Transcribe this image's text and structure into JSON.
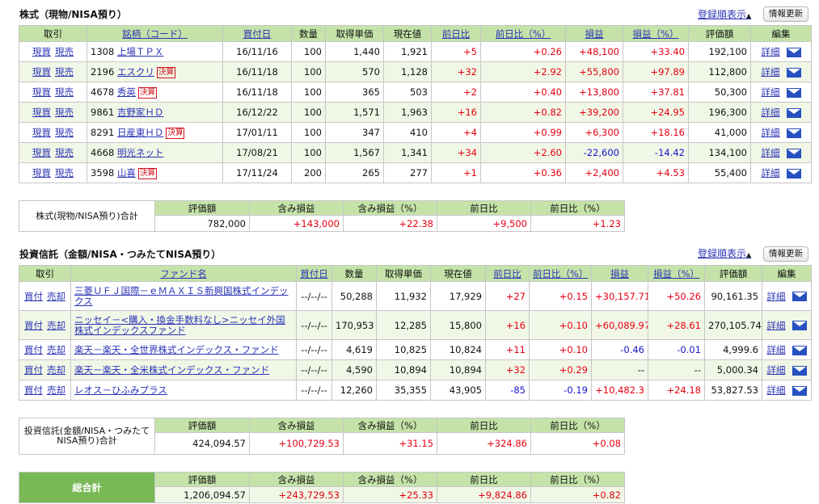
{
  "stocks": {
    "title": "株式（現物/NISA預り）",
    "sort_label": "登録順表示",
    "refresh_label": "情報更新",
    "headers": [
      "取引",
      "銘柄（コード）",
      "買付日",
      "数量",
      "取得単価",
      "現在値",
      "前日比",
      "前日比（%）",
      "損益",
      "損益（%）",
      "評価額",
      "編集"
    ],
    "trade_buy": "現買",
    "trade_sell": "現売",
    "detail_label": "詳細",
    "kessan_label": "決算",
    "rows": [
      {
        "code": "1308",
        "name": "上場ＴＰＸ",
        "kessan": false,
        "date": "16/11/16",
        "qty": "100",
        "cost": "1,440",
        "price": "1,921",
        "chg": "+5",
        "chgpct": "+0.26",
        "pl": "+48,100",
        "plpct": "+33.40",
        "value": "192,100"
      },
      {
        "code": "2196",
        "name": "エスクリ",
        "kessan": true,
        "date": "16/11/18",
        "qty": "100",
        "cost": "570",
        "price": "1,128",
        "chg": "+32",
        "chgpct": "+2.92",
        "pl": "+55,800",
        "plpct": "+97.89",
        "value": "112,800"
      },
      {
        "code": "4678",
        "name": "秀英",
        "kessan": true,
        "date": "16/11/18",
        "qty": "100",
        "cost": "365",
        "price": "503",
        "chg": "+2",
        "chgpct": "+0.40",
        "pl": "+13,800",
        "plpct": "+37.81",
        "value": "50,300"
      },
      {
        "code": "9861",
        "name": "吉野家ＨＤ",
        "kessan": false,
        "date": "16/12/22",
        "qty": "100",
        "cost": "1,571",
        "price": "1,963",
        "chg": "+16",
        "chgpct": "+0.82",
        "pl": "+39,200",
        "plpct": "+24.95",
        "value": "196,300"
      },
      {
        "code": "8291",
        "name": "日産東ＨＤ",
        "kessan": true,
        "date": "17/01/11",
        "qty": "100",
        "cost": "347",
        "price": "410",
        "chg": "+4",
        "chgpct": "+0.99",
        "pl": "+6,300",
        "plpct": "+18.16",
        "value": "41,000"
      },
      {
        "code": "4668",
        "name": "明光ネット",
        "kessan": false,
        "date": "17/08/21",
        "qty": "100",
        "cost": "1,567",
        "price": "1,341",
        "chg": "+34",
        "chgpct": "+2.60",
        "pl": "-22,600",
        "plpct": "-14.42",
        "value": "134,100"
      },
      {
        "code": "3598",
        "name": "山喜",
        "kessan": true,
        "date": "17/11/24",
        "qty": "200",
        "cost": "265",
        "price": "277",
        "chg": "+1",
        "chgpct": "+0.36",
        "pl": "+2,400",
        "plpct": "+4.53",
        "value": "55,400"
      }
    ],
    "total": {
      "label": "株式(現物/NISA預り)合計",
      "headers": [
        "評価額",
        "含み損益",
        "含み損益（%）",
        "前日比",
        "前日比（%）"
      ],
      "values": [
        "782,000",
        "+143,000",
        "+22.38",
        "+9,500",
        "+1.23"
      ]
    }
  },
  "funds": {
    "title": "投資信託（金額/NISA・つみたてNISA預り）",
    "sort_label": "登録順表示",
    "refresh_label": "情報更新",
    "headers": [
      "取引",
      "ファンド名",
      "買付日",
      "数量",
      "取得単価",
      "現在値",
      "前日比",
      "前日比（%）",
      "損益",
      "損益（%）",
      "評価額",
      "編集"
    ],
    "trade_buy": "買付",
    "trade_sell": "売却",
    "detail_label": "詳細",
    "rows": [
      {
        "name": "三菱ＵＦＪ国際－ｅＭＡＸＩＳ新興国株式インデックス",
        "date": "--/--/--",
        "qty": "50,288",
        "cost": "11,932",
        "price": "17,929",
        "chg": "+27",
        "chgpct": "+0.15",
        "pl": "+30,157.71",
        "plpct": "+50.26",
        "value": "90,161.35"
      },
      {
        "name": "ニッセイ－<購入・換金手数料なし>ニッセイ外国株式インデックスファンド",
        "date": "--/--/--",
        "qty": "170,953",
        "cost": "12,285",
        "price": "15,800",
        "chg": "+16",
        "chgpct": "+0.10",
        "pl": "+60,089.97",
        "plpct": "+28.61",
        "value": "270,105.74"
      },
      {
        "name": "楽天－楽天・全世界株式インデックス・ファンド",
        "date": "--/--/--",
        "qty": "4,619",
        "cost": "10,825",
        "price": "10,824",
        "chg": "+11",
        "chgpct": "+0.10",
        "pl": "-0.46",
        "plpct": "-0.01",
        "value": "4,999.6"
      },
      {
        "name": "楽天－楽天・全米株式インデックス・ファンド",
        "date": "--/--/--",
        "qty": "4,590",
        "cost": "10,894",
        "price": "10,894",
        "chg": "+32",
        "chgpct": "+0.29",
        "pl": "--",
        "plpct": "--",
        "value": "5,000.34"
      },
      {
        "name": "レオス－ひふみプラス",
        "date": "--/--/--",
        "qty": "12,260",
        "cost": "35,355",
        "price": "43,905",
        "chg": "-85",
        "chgpct": "-0.19",
        "pl": "+10,482.3",
        "plpct": "+24.18",
        "value": "53,827.53"
      }
    ],
    "total": {
      "label": "投資信託(金額/NISA・つみたてNISA預り)合計",
      "headers": [
        "評価額",
        "含み損益",
        "含み損益（%）",
        "前日比",
        "前日比（%）"
      ],
      "values": [
        "424,094.57",
        "+100,729.53",
        "+31.15",
        "+324.86",
        "+0.08"
      ]
    }
  },
  "grand_total": {
    "label": "総合計",
    "headers": [
      "評価額",
      "含み損益",
      "含み損益（%）",
      "前日比",
      "前日比（%）"
    ],
    "values": [
      "1,206,094.57",
      "+243,729.53",
      "+25.33",
      "+9,824.86",
      "+0.82"
    ]
  },
  "colors": {
    "header_bg": "#c5e3a9",
    "positive": "#e60012",
    "negative": "#1414c8",
    "grand_total_bg": "#78b955",
    "link": "#2a33b5"
  }
}
